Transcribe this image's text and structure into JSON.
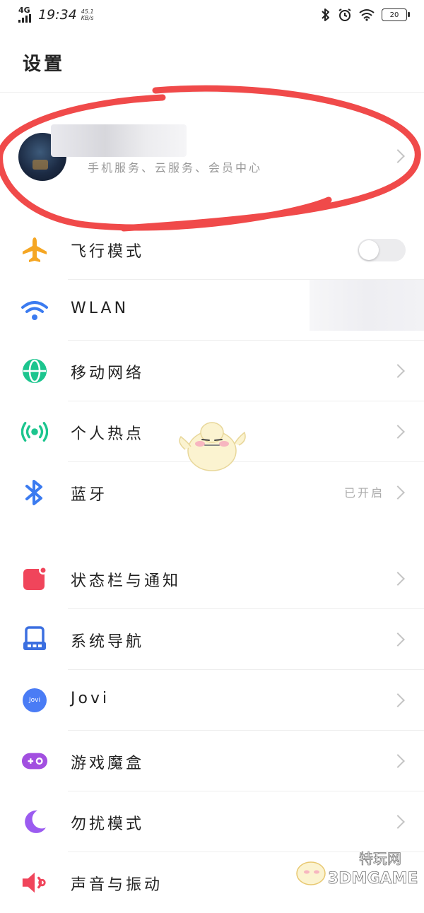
{
  "status_bar": {
    "network": "4G",
    "time": "19:34",
    "speed_value": "45.1",
    "speed_unit": "KB/s",
    "battery": "20",
    "icons": [
      "bluetooth-icon",
      "alarm-icon",
      "wifi-icon",
      "battery-icon"
    ]
  },
  "page_title": "设置",
  "profile": {
    "subtitle": "手机服务、云服务、会员中心"
  },
  "settings_group_1": [
    {
      "label": "飞行模式",
      "icon": "airplane-icon",
      "color": "#F5A623",
      "control": "toggle",
      "toggle_on": false
    },
    {
      "label": "WLAN",
      "icon": "wifi-icon",
      "color": "#3B7BF0"
    },
    {
      "label": "移动网络",
      "icon": "globe-icon",
      "color": "#1CC58E"
    },
    {
      "label": "个人热点",
      "icon": "hotspot-icon",
      "color": "#1CC58E"
    },
    {
      "label": "蓝牙",
      "icon": "bluetooth-icon",
      "color": "#3B7BF0",
      "value": "已开启"
    }
  ],
  "settings_group_2": [
    {
      "label": "状态栏与通知",
      "icon": "notification-icon",
      "color": "#F0455B"
    },
    {
      "label": "系统导航",
      "icon": "navigation-icon",
      "color": "#3B6FE0"
    },
    {
      "label": "Jovi",
      "icon": "jovi-icon",
      "color": "#4A7CF5",
      "icon_text": "Jovi"
    },
    {
      "label": "游戏魔盒",
      "icon": "gamebox-icon",
      "color": "#A24FE0"
    },
    {
      "label": "勿扰模式",
      "icon": "moon-icon",
      "color": "#9B5BF0"
    },
    {
      "label": "声音与振动",
      "icon": "speaker-icon",
      "color": "#F0455B"
    }
  ],
  "watermark": {
    "brand": "特玩网",
    "site": "3DMGAME"
  }
}
